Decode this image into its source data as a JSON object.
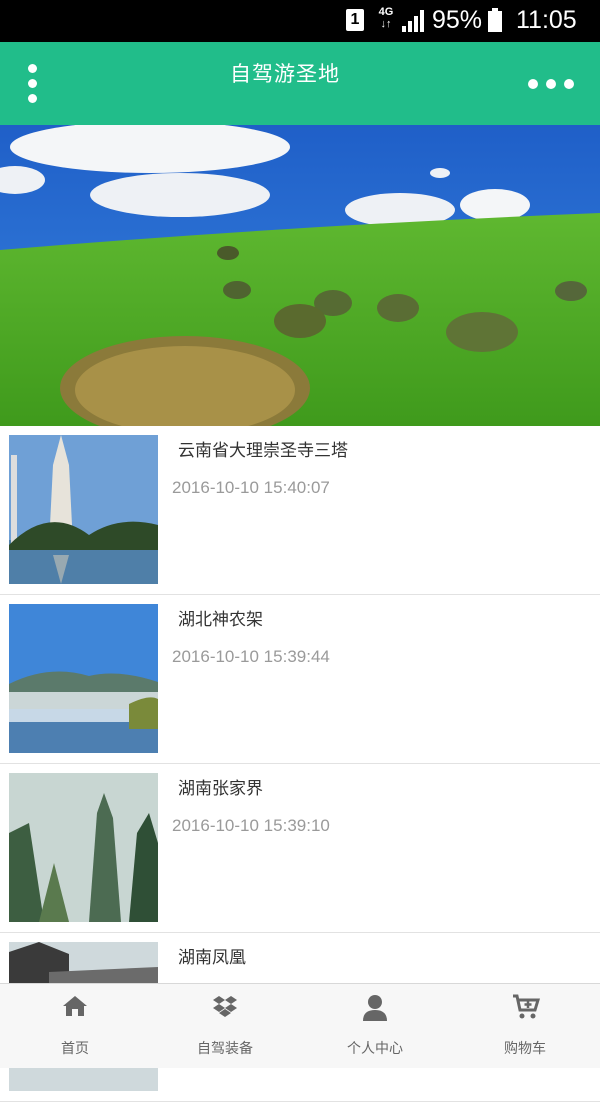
{
  "status_bar": {
    "sim": "1",
    "network": "4G",
    "battery": "95%",
    "time": "11:05"
  },
  "app_bar": {
    "title": "自驾游圣地"
  },
  "list": {
    "items": [
      {
        "title": "云南省大理崇圣寺三塔",
        "time": "2016-10-10 15:40:07"
      },
      {
        "title": "湖北神农架",
        "time": "2016-10-10 15:39:44"
      },
      {
        "title": "湖南张家界",
        "time": "2016-10-10 15:39:10"
      },
      {
        "title": "湖南凤凰",
        "time": ""
      }
    ]
  },
  "bottom_nav": {
    "items": [
      {
        "label": "首页",
        "icon": "home-icon"
      },
      {
        "label": "自驾装备",
        "icon": "dropbox-icon"
      },
      {
        "label": "个人中心",
        "icon": "user-icon"
      },
      {
        "label": "购物车",
        "icon": "cart-icon"
      }
    ]
  },
  "colors": {
    "accent": "#21bd8a",
    "status_bar": "#000000",
    "nav_text": "#666666",
    "time_text": "#9a9a9a"
  }
}
